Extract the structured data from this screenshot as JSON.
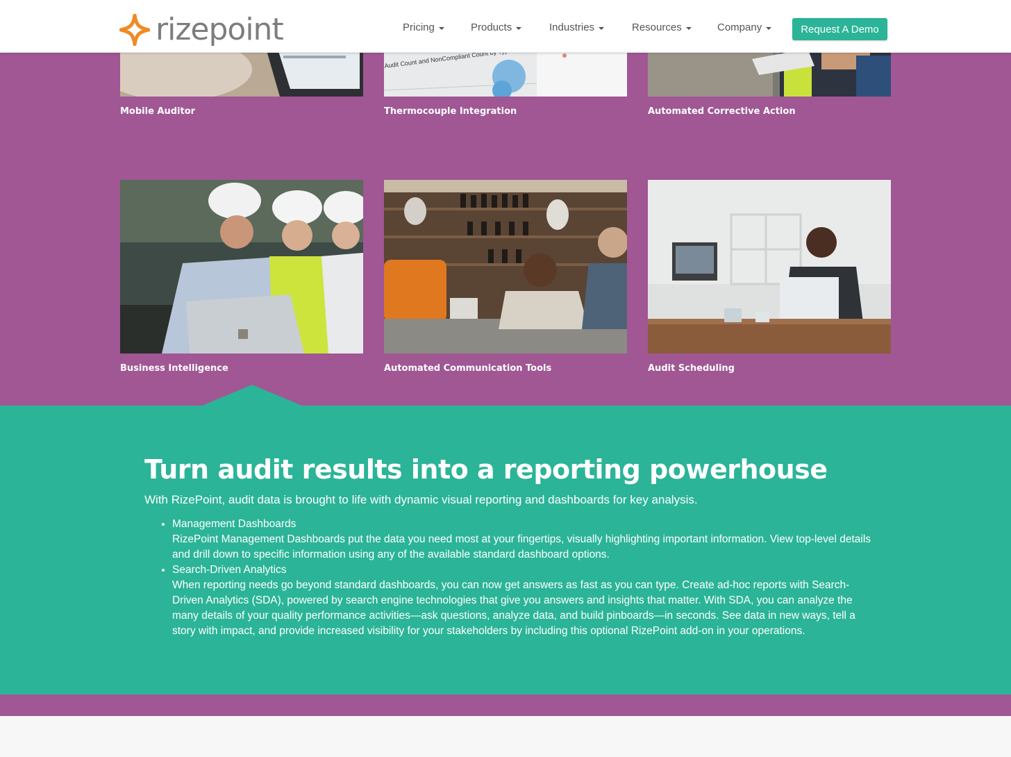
{
  "brand": {
    "logo_text": "rizepoint",
    "accent_color": "#2bb497",
    "purple_color": "#a05794",
    "logo_star_color": "#f08a24"
  },
  "nav": {
    "items": [
      {
        "label": "Pricing"
      },
      {
        "label": "Products"
      },
      {
        "label": "Industries"
      },
      {
        "label": "Resources"
      },
      {
        "label": "Company"
      }
    ],
    "cta_label": "Request A Demo"
  },
  "features": {
    "row1": [
      {
        "caption": "Mobile Auditor",
        "image": "tablet-audit-photo"
      },
      {
        "caption": "Thermocouple Integration",
        "image": "chart-printout-photo",
        "image_text": "Audit Count and NonCompliant Count by Type"
      },
      {
        "caption": "Automated Corrective Action",
        "image": "warehouse-worker-tablet-photo"
      }
    ],
    "row2": [
      {
        "caption": "Business Intelligence",
        "image": "engineers-hardhats-laptop-photo"
      },
      {
        "caption": "Automated Communication Tools",
        "image": "restaurant-staff-photo"
      },
      {
        "caption": "Audit Scheduling",
        "image": "woman-laptop-office-photo"
      }
    ]
  },
  "reporting": {
    "heading": "Turn audit results into a reporting powerhouse",
    "intro": "With RizePoint, audit data is brought to life with dynamic visual reporting and dashboards for key analysis.",
    "items": [
      {
        "title": "Management Dashboards",
        "body": "RizePoint Management Dashboards put the data you need most at your fingertips, visually highlighting important information. View top-level details and drill down to specific information using any of the available standard dashboard options."
      },
      {
        "title": "Search-Driven Analytics",
        "body": "When reporting needs go beyond standard dashboards, you can now get answers as fast as you can type. Create ad-hoc reports with Search-Driven Analytics (SDA), powered by search engine technologies that give you answers and insights that matter. With SDA, you can analyze the many details of your quality performance activities—ask questions, analyze data, and build pinboards—in seconds. See data in new ways, tell a story with impact, and provide increased visibility for your stakeholders by including this optional RizePoint add-on in your operations."
      }
    ]
  }
}
